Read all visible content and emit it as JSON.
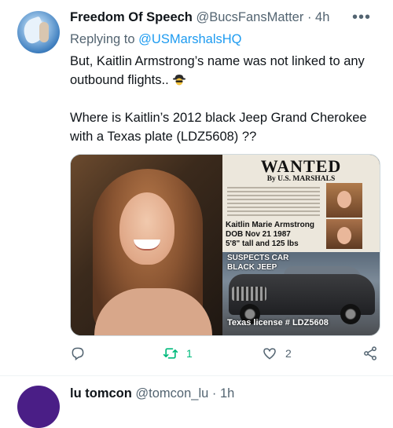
{
  "tweet": {
    "author_name": "Freedom Of Speech",
    "author_handle": "@BucsFansMatter",
    "separator": "·",
    "time": "4h",
    "more": "•••",
    "replying_prefix": "Replying to",
    "replying_mention": "@USMarshalsHQ",
    "line1": "But, Kaitlin Armstrong’s name was not linked to any outbound flights..",
    "line2": "Where is Kaitlin’s 2012 black Jeep Grand Cherokee with a Texas plate (LDZ5608) ??"
  },
  "media": {
    "poster_title": "WANTED",
    "poster_by": "By U.S. MARSHALS",
    "poster_name": "Kaitlin Marie Armstrong",
    "poster_dob": "DOB Nov 21 1987",
    "poster_height": "5'8\" tall and 125 lbs",
    "suspects_car": "SUSPECTS CAR",
    "black_jeep": "BLACK JEEP",
    "plate": "Texas license # LDZ5608"
  },
  "actions": {
    "reply_count": "",
    "retweet_count": "1",
    "like_count": "2"
  },
  "next_tweet": {
    "author_name": "lu tomcon",
    "author_handle": "@tomcon_lu",
    "separator": "·",
    "time": "1h"
  },
  "colors": {
    "accent": "#1d9bf0",
    "retweet_active": "#00ba7c",
    "secondary_text": "#536471"
  },
  "icons": [
    "reply-icon",
    "retweet-icon",
    "like-icon",
    "share-icon",
    "more-icon",
    "spy-emoji-icon"
  ]
}
